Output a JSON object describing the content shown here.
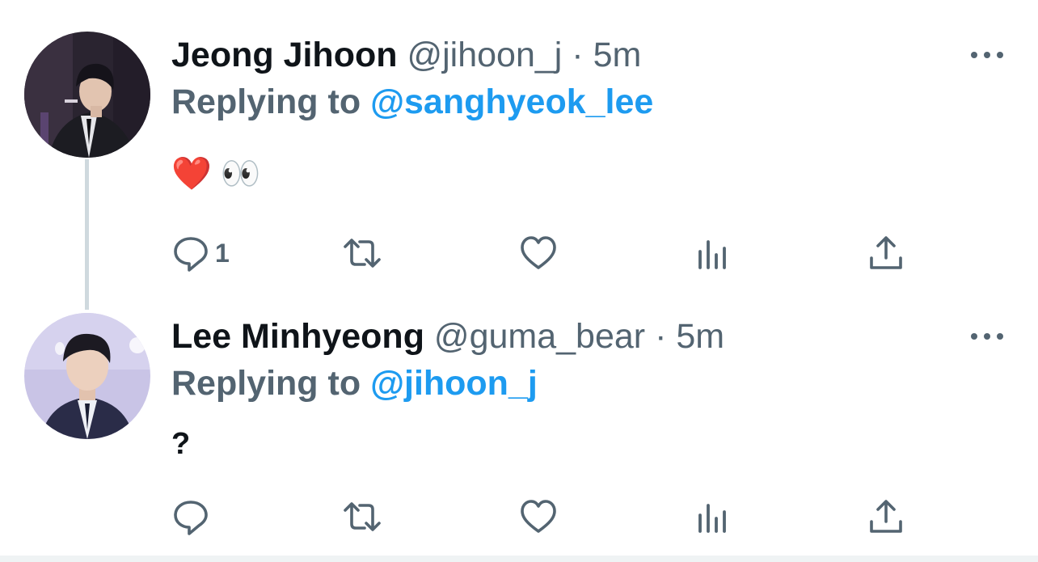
{
  "tweets": [
    {
      "display_name": "Jeong Jihoon",
      "handle": "@jihoon_j",
      "separator": "·",
      "time": "5m",
      "reply_label": "Replying to",
      "reply_to": "@sanghyeok_lee",
      "body": "❤️ 👀",
      "reply_count": "1",
      "icons": [
        "reply-icon",
        "retweet-icon",
        "like-icon",
        "views-icon",
        "share-icon",
        "more-icon"
      ]
    },
    {
      "display_name": "Lee Minhyeong",
      "handle": "@guma_bear",
      "separator": "·",
      "time": "5m",
      "reply_label": "Replying to",
      "reply_to": "@jihoon_j",
      "body": "?",
      "reply_count": "",
      "icons": [
        "reply-icon",
        "retweet-icon",
        "like-icon",
        "views-icon",
        "share-icon",
        "more-icon"
      ]
    }
  ],
  "colors": {
    "text_primary": "#0f1419",
    "text_secondary": "#536471",
    "accent": "#1d9bf0",
    "thread_line": "#cfd9de",
    "background": "#ffffff"
  }
}
